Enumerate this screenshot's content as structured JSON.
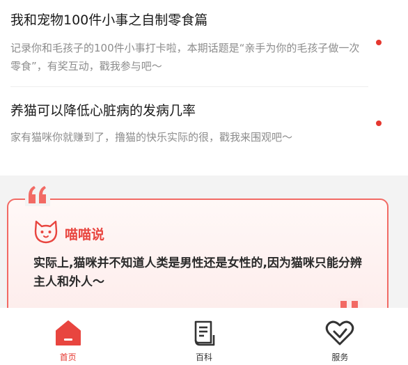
{
  "articles": [
    {
      "title": "我和宠物100件小事之自制零食篇",
      "desc": "记录你和毛孩子的100件小事打卡啦，本期话题是“亲手为你的毛孩子做一次零食”，有奖互动，戳我参与吧～"
    },
    {
      "title": "养猫可以降低心脏病的发病几率",
      "desc": "家有猫咪你就赚到了，撸猫的快乐实际的很，戳我来围观吧～"
    }
  ],
  "quote_card": {
    "label": "喵喵说",
    "text": "实际上,猫咪并不知道人类是男性还是女性的,因为猫咪只能分辨主人和外人～",
    "icon": "cat-face-icon"
  },
  "tabbar": {
    "items": [
      {
        "label": "首页",
        "icon": "home-icon",
        "active": true
      },
      {
        "label": "百科",
        "icon": "book-icon",
        "active": false
      },
      {
        "label": "服务",
        "icon": "heart-service-icon",
        "active": false
      }
    ]
  },
  "colors": {
    "accent": "#e5372f",
    "card_border": "#f26a64",
    "background_gray": "#f3f3f3"
  }
}
